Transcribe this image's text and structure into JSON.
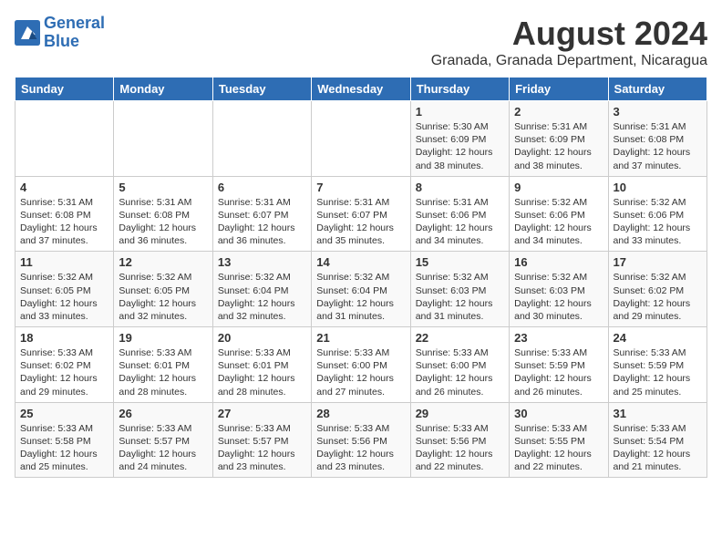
{
  "logo": {
    "line1": "General",
    "line2": "Blue"
  },
  "title": "August 2024",
  "location": "Granada, Granada Department, Nicaragua",
  "days_of_week": [
    "Sunday",
    "Monday",
    "Tuesday",
    "Wednesday",
    "Thursday",
    "Friday",
    "Saturday"
  ],
  "weeks": [
    [
      {
        "day": "",
        "info": ""
      },
      {
        "day": "",
        "info": ""
      },
      {
        "day": "",
        "info": ""
      },
      {
        "day": "",
        "info": ""
      },
      {
        "day": "1",
        "info": "Sunrise: 5:30 AM\nSunset: 6:09 PM\nDaylight: 12 hours\nand 38 minutes."
      },
      {
        "day": "2",
        "info": "Sunrise: 5:31 AM\nSunset: 6:09 PM\nDaylight: 12 hours\nand 38 minutes."
      },
      {
        "day": "3",
        "info": "Sunrise: 5:31 AM\nSunset: 6:08 PM\nDaylight: 12 hours\nand 37 minutes."
      }
    ],
    [
      {
        "day": "4",
        "info": "Sunrise: 5:31 AM\nSunset: 6:08 PM\nDaylight: 12 hours\nand 37 minutes."
      },
      {
        "day": "5",
        "info": "Sunrise: 5:31 AM\nSunset: 6:08 PM\nDaylight: 12 hours\nand 36 minutes."
      },
      {
        "day": "6",
        "info": "Sunrise: 5:31 AM\nSunset: 6:07 PM\nDaylight: 12 hours\nand 36 minutes."
      },
      {
        "day": "7",
        "info": "Sunrise: 5:31 AM\nSunset: 6:07 PM\nDaylight: 12 hours\nand 35 minutes."
      },
      {
        "day": "8",
        "info": "Sunrise: 5:31 AM\nSunset: 6:06 PM\nDaylight: 12 hours\nand 34 minutes."
      },
      {
        "day": "9",
        "info": "Sunrise: 5:32 AM\nSunset: 6:06 PM\nDaylight: 12 hours\nand 34 minutes."
      },
      {
        "day": "10",
        "info": "Sunrise: 5:32 AM\nSunset: 6:06 PM\nDaylight: 12 hours\nand 33 minutes."
      }
    ],
    [
      {
        "day": "11",
        "info": "Sunrise: 5:32 AM\nSunset: 6:05 PM\nDaylight: 12 hours\nand 33 minutes."
      },
      {
        "day": "12",
        "info": "Sunrise: 5:32 AM\nSunset: 6:05 PM\nDaylight: 12 hours\nand 32 minutes."
      },
      {
        "day": "13",
        "info": "Sunrise: 5:32 AM\nSunset: 6:04 PM\nDaylight: 12 hours\nand 32 minutes."
      },
      {
        "day": "14",
        "info": "Sunrise: 5:32 AM\nSunset: 6:04 PM\nDaylight: 12 hours\nand 31 minutes."
      },
      {
        "day": "15",
        "info": "Sunrise: 5:32 AM\nSunset: 6:03 PM\nDaylight: 12 hours\nand 31 minutes."
      },
      {
        "day": "16",
        "info": "Sunrise: 5:32 AM\nSunset: 6:03 PM\nDaylight: 12 hours\nand 30 minutes."
      },
      {
        "day": "17",
        "info": "Sunrise: 5:32 AM\nSunset: 6:02 PM\nDaylight: 12 hours\nand 29 minutes."
      }
    ],
    [
      {
        "day": "18",
        "info": "Sunrise: 5:33 AM\nSunset: 6:02 PM\nDaylight: 12 hours\nand 29 minutes."
      },
      {
        "day": "19",
        "info": "Sunrise: 5:33 AM\nSunset: 6:01 PM\nDaylight: 12 hours\nand 28 minutes."
      },
      {
        "day": "20",
        "info": "Sunrise: 5:33 AM\nSunset: 6:01 PM\nDaylight: 12 hours\nand 28 minutes."
      },
      {
        "day": "21",
        "info": "Sunrise: 5:33 AM\nSunset: 6:00 PM\nDaylight: 12 hours\nand 27 minutes."
      },
      {
        "day": "22",
        "info": "Sunrise: 5:33 AM\nSunset: 6:00 PM\nDaylight: 12 hours\nand 26 minutes."
      },
      {
        "day": "23",
        "info": "Sunrise: 5:33 AM\nSunset: 5:59 PM\nDaylight: 12 hours\nand 26 minutes."
      },
      {
        "day": "24",
        "info": "Sunrise: 5:33 AM\nSunset: 5:59 PM\nDaylight: 12 hours\nand 25 minutes."
      }
    ],
    [
      {
        "day": "25",
        "info": "Sunrise: 5:33 AM\nSunset: 5:58 PM\nDaylight: 12 hours\nand 25 minutes."
      },
      {
        "day": "26",
        "info": "Sunrise: 5:33 AM\nSunset: 5:57 PM\nDaylight: 12 hours\nand 24 minutes."
      },
      {
        "day": "27",
        "info": "Sunrise: 5:33 AM\nSunset: 5:57 PM\nDaylight: 12 hours\nand 23 minutes."
      },
      {
        "day": "28",
        "info": "Sunrise: 5:33 AM\nSunset: 5:56 PM\nDaylight: 12 hours\nand 23 minutes."
      },
      {
        "day": "29",
        "info": "Sunrise: 5:33 AM\nSunset: 5:56 PM\nDaylight: 12 hours\nand 22 minutes."
      },
      {
        "day": "30",
        "info": "Sunrise: 5:33 AM\nSunset: 5:55 PM\nDaylight: 12 hours\nand 22 minutes."
      },
      {
        "day": "31",
        "info": "Sunrise: 5:33 AM\nSunset: 5:54 PM\nDaylight: 12 hours\nand 21 minutes."
      }
    ]
  ]
}
